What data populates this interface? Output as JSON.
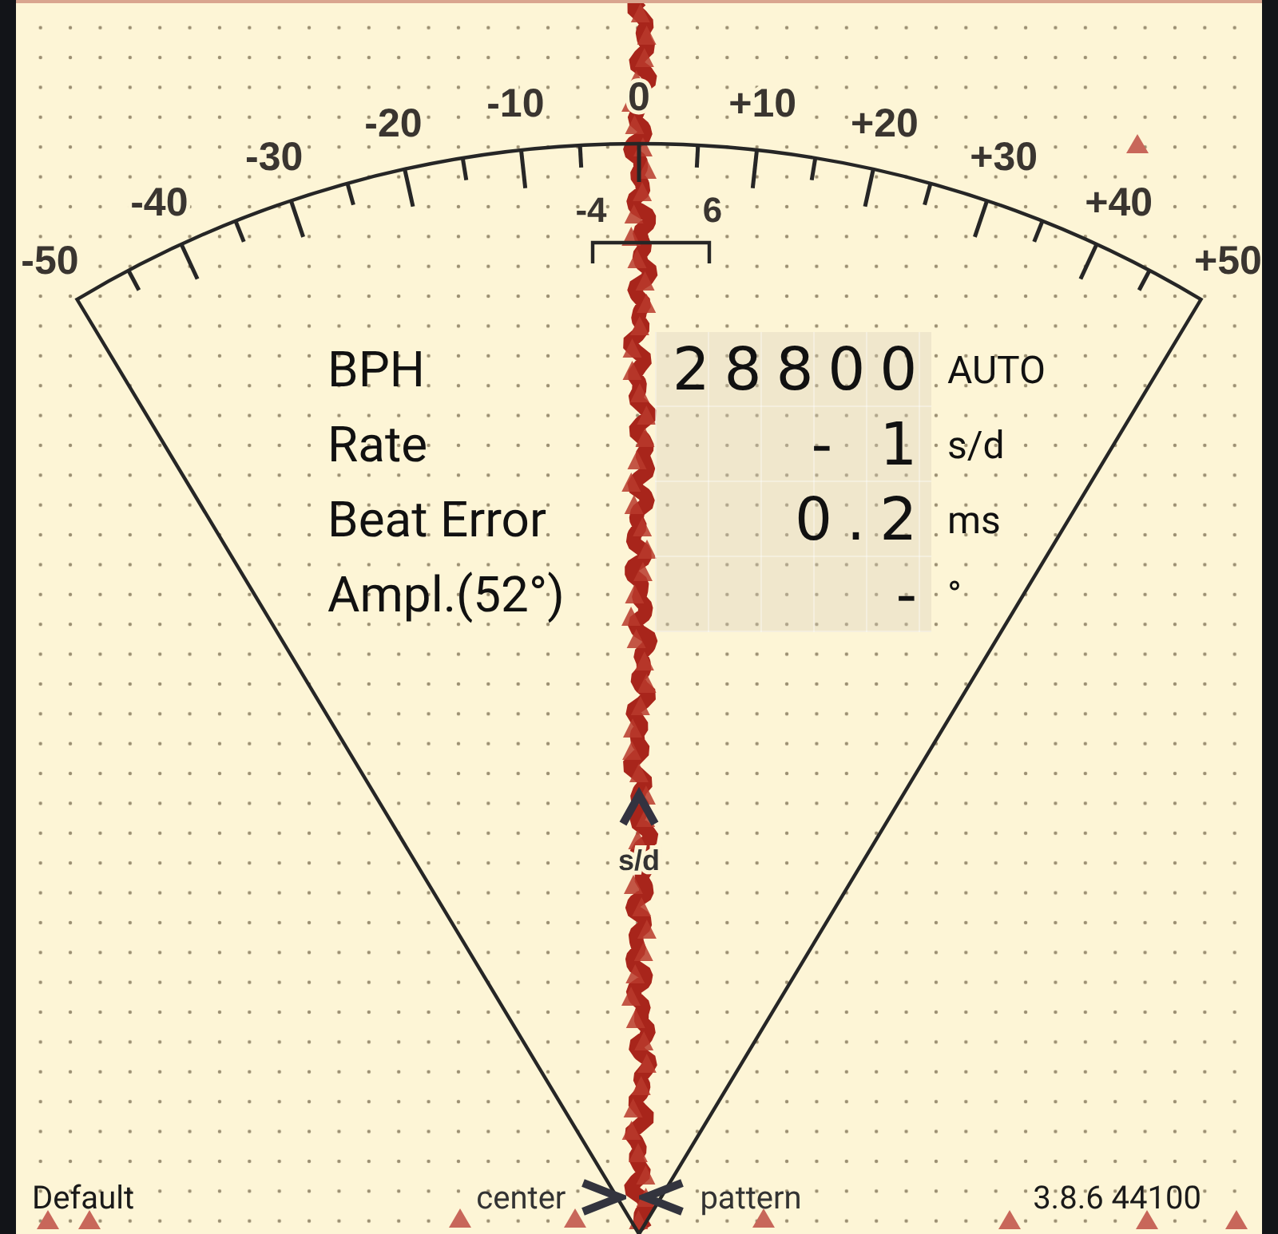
{
  "scale": {
    "labels": [
      "-50",
      "-40",
      "-30",
      "-20",
      "-10",
      "0",
      "+10",
      "+20",
      "+30",
      "+40",
      "+50"
    ],
    "bracket": {
      "low": "-4",
      "high": "6"
    },
    "unit": "s/d"
  },
  "readings": [
    {
      "label": "BPH",
      "value": "28800",
      "unit": "AUTO"
    },
    {
      "label": "Rate",
      "value": "- 1",
      "unit": "s/d"
    },
    {
      "label": "Beat Error",
      "value": "0.2",
      "unit": "ms"
    },
    {
      "label": "Ampl.(52°)",
      "value": "-",
      "unit": "°"
    }
  ],
  "status_bar": {
    "left": "Default",
    "center_left": "center",
    "center_right": "pattern",
    "right": "3.8.6 44100"
  }
}
